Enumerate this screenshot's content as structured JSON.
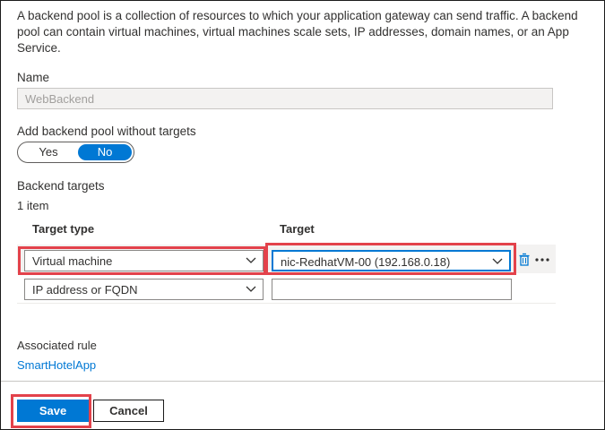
{
  "description": "A backend pool is a collection of resources to which your application gateway can send traffic. A backend pool can contain virtual machines, virtual machines scale sets, IP addresses, domain names, or an App Service.",
  "name_section": {
    "label": "Name",
    "value": "WebBackend"
  },
  "without_targets": {
    "label": "Add backend pool without targets",
    "options": [
      "Yes",
      "No"
    ],
    "selected": "No"
  },
  "backend_targets": {
    "label": "Backend targets",
    "count": "1 item",
    "columns": {
      "target_type": "Target type",
      "target": "Target"
    },
    "rows": [
      {
        "target_type": "Virtual machine",
        "target": "nic-RedhatVM-00 (192.168.0.18)"
      },
      {
        "target_type": "IP address or FQDN",
        "target": ""
      }
    ]
  },
  "associated_rule": {
    "label": "Associated rule",
    "value": "SmartHotelApp"
  },
  "footer": {
    "save_label": "Save",
    "cancel_label": "Cancel"
  },
  "colors": {
    "accent": "#0078d4",
    "highlight": "#e3424b"
  }
}
